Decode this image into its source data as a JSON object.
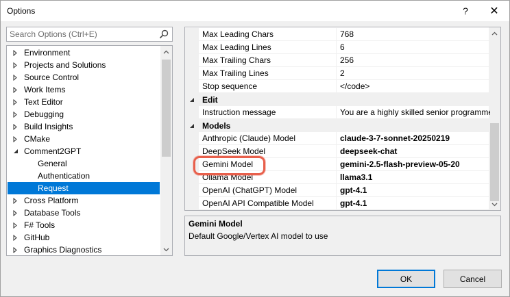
{
  "window": {
    "title": "Options",
    "help_label": "?",
    "close_label": "✕"
  },
  "search": {
    "placeholder": "Search Options (Ctrl+E)"
  },
  "tree": {
    "items": [
      {
        "label": "Environment",
        "level": 0,
        "expanded": false
      },
      {
        "label": "Projects and Solutions",
        "level": 0,
        "expanded": false
      },
      {
        "label": "Source Control",
        "level": 0,
        "expanded": false
      },
      {
        "label": "Work Items",
        "level": 0,
        "expanded": false
      },
      {
        "label": "Text Editor",
        "level": 0,
        "expanded": false
      },
      {
        "label": "Debugging",
        "level": 0,
        "expanded": false
      },
      {
        "label": "Build Insights",
        "level": 0,
        "expanded": false
      },
      {
        "label": "CMake",
        "level": 0,
        "expanded": false
      },
      {
        "label": "Comment2GPT",
        "level": 0,
        "expanded": true
      },
      {
        "label": "General",
        "level": 1
      },
      {
        "label": "Authentication",
        "level": 1
      },
      {
        "label": "Request",
        "level": 1,
        "selected": true
      },
      {
        "label": "Cross Platform",
        "level": 0,
        "expanded": false
      },
      {
        "label": "Database Tools",
        "level": 0,
        "expanded": false
      },
      {
        "label": "F# Tools",
        "level": 0,
        "expanded": false
      },
      {
        "label": "GitHub",
        "level": 0,
        "expanded": false
      },
      {
        "label": "Graphics Diagnostics",
        "level": 0,
        "expanded": false
      }
    ]
  },
  "grid": {
    "rows": [
      {
        "type": "prop",
        "name": "Max Leading Chars",
        "value": "768",
        "bold": false
      },
      {
        "type": "prop",
        "name": "Max Leading Lines",
        "value": "6",
        "bold": false
      },
      {
        "type": "prop",
        "name": "Max Trailing Chars",
        "value": "256",
        "bold": false
      },
      {
        "type": "prop",
        "name": "Max Trailing Lines",
        "value": "2",
        "bold": false
      },
      {
        "type": "prop",
        "name": "Stop sequence",
        "value": "</code>",
        "bold": false
      },
      {
        "type": "category",
        "name": "Edit"
      },
      {
        "type": "prop",
        "name": "Instruction message",
        "value": "You are a highly skilled senior programme",
        "bold": false
      },
      {
        "type": "category",
        "name": "Models"
      },
      {
        "type": "prop",
        "name": "Anthropic (Claude) Model",
        "value": "claude-3-7-sonnet-20250219",
        "bold": true
      },
      {
        "type": "prop",
        "name": "DeepSeek Model",
        "value": "deepseek-chat",
        "bold": true
      },
      {
        "type": "prop",
        "name": "Gemini Model",
        "value": "gemini-2.5-flash-preview-05-20",
        "bold": true
      },
      {
        "type": "prop",
        "name": "Ollama Model",
        "value": "llama3.1",
        "bold": true
      },
      {
        "type": "prop",
        "name": "OpenAI (ChatGPT) Model",
        "value": "gpt-4.1",
        "bold": true
      },
      {
        "type": "prop",
        "name": "OpenAI API Compatible Model",
        "value": "gpt-4.1",
        "bold": true
      }
    ]
  },
  "description": {
    "title": "Gemini Model",
    "text": "Default Google/Vertex AI model to use"
  },
  "buttons": {
    "ok_label": "OK",
    "cancel_label": "Cancel"
  },
  "colors": {
    "selection": "#0078d7",
    "highlight_ring": "#e8604c"
  }
}
